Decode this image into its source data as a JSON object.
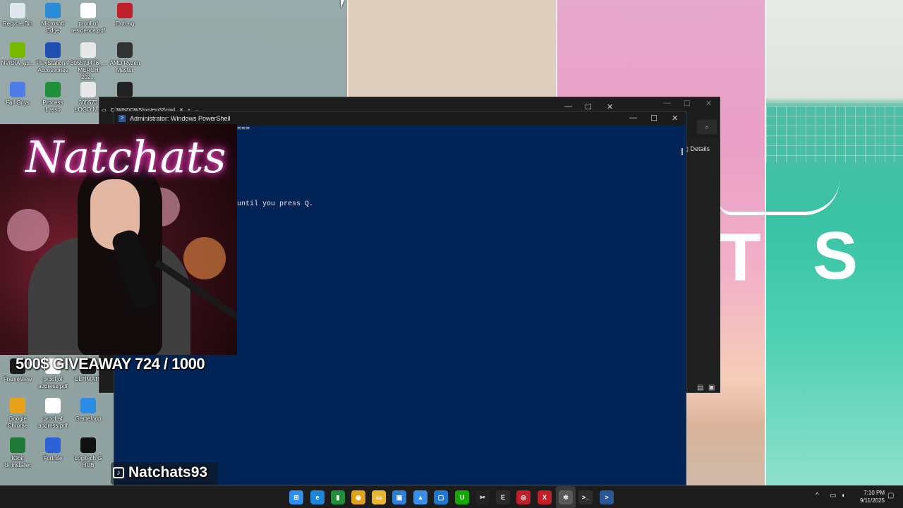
{
  "desktop": {
    "icons": [
      {
        "label": "Recycle Bin",
        "color": "#dfe7ef"
      },
      {
        "label": "Microsoft Edge",
        "color": "#2a8bd6"
      },
      {
        "label": "proof of residence.pdf",
        "color": "#ffffff"
      },
      {
        "label": "ExitLag",
        "color": "#c0202a"
      },
      {
        "label": "NVIDIA_ap...",
        "color": "#76b900"
      },
      {
        "label": "PlayStation® Accessories",
        "color": "#1f4fb5"
      },
      {
        "label": "305573476_... MERCH 202...",
        "color": "#e7e7e7"
      },
      {
        "label": "AMD Ryzen Master",
        "color": "#333333"
      },
      {
        "label": "Fall Guys",
        "color": "#4f7de8"
      },
      {
        "label": "Process Lasso",
        "color": "#1f8f3a"
      },
      {
        "label": "305573 LOGO N...",
        "color": "#e7e7e7"
      },
      {
        "label": "",
        "color": "#222222"
      },
      {
        "label": "FrameView",
        "color": "#1a1a1a"
      },
      {
        "label": "proof of address.pdf",
        "color": "#ffffff"
      },
      {
        "label": "ULTIMATE",
        "color": "#1a1a1a"
      },
      {
        "label": "Google Chrome",
        "color": "#e8a21a"
      },
      {
        "label": "proof af address.pdf",
        "color": "#ffffff"
      },
      {
        "label": "Gameloop",
        "color": "#2b8ce6"
      },
      {
        "label": "IObit Uninstaller",
        "color": "#1f7a33"
      },
      {
        "label": "Fortnite",
        "color": "#2b62d8"
      },
      {
        "label": "Logitech G HUB",
        "color": "#101010"
      }
    ]
  },
  "back_window": {
    "tab_title": "C:\\WINDOWS\\system32\\cmd",
    "details_label": "Details"
  },
  "powershell": {
    "title": "Administrator: Windows PowerShell",
    "lines": [
      "===",
      "until you press Q."
    ]
  },
  "stream_overlay": {
    "neon_sign": "Natchats",
    "giveaway": "500$ GIVEAWAY  724 / 1000",
    "handle": "Natchats93"
  },
  "wallpaper": {
    "letters": [
      "T",
      "S"
    ]
  },
  "taskbar": {
    "apps": [
      {
        "name": "start",
        "glyph": "⊞",
        "color": "#2f8ff0"
      },
      {
        "name": "edge",
        "glyph": "e",
        "color": "#1e86d8"
      },
      {
        "name": "excel",
        "glyph": "▮",
        "color": "#1f8f3a"
      },
      {
        "name": "chrome",
        "glyph": "◉",
        "color": "#e0a21a"
      },
      {
        "name": "explorer",
        "glyph": "▭",
        "color": "#e8b631"
      },
      {
        "name": "store",
        "glyph": "▣",
        "color": "#2e7fd6"
      },
      {
        "name": "photos",
        "glyph": "▲",
        "color": "#3a8ee8"
      },
      {
        "name": "remote",
        "glyph": "▢",
        "color": "#1f78d0"
      },
      {
        "name": "upwork",
        "glyph": "U",
        "color": "#14a800"
      },
      {
        "name": "capcut",
        "glyph": "✂",
        "color": "#222222"
      },
      {
        "name": "epic",
        "glyph": "E",
        "color": "#2a2a2a"
      },
      {
        "name": "amd",
        "glyph": "◎",
        "color": "#c0202a"
      },
      {
        "name": "exitlag",
        "glyph": "X",
        "color": "#c0202a"
      },
      {
        "name": "settings",
        "glyph": "✲",
        "color": "#5a5a5a"
      },
      {
        "name": "terminal",
        "glyph": ">_",
        "color": "#2d2d2d"
      },
      {
        "name": "powershell",
        "glyph": ">",
        "color": "#2b5797"
      }
    ],
    "clock_time": "7:10 PM",
    "clock_date": "9/11/2025"
  }
}
